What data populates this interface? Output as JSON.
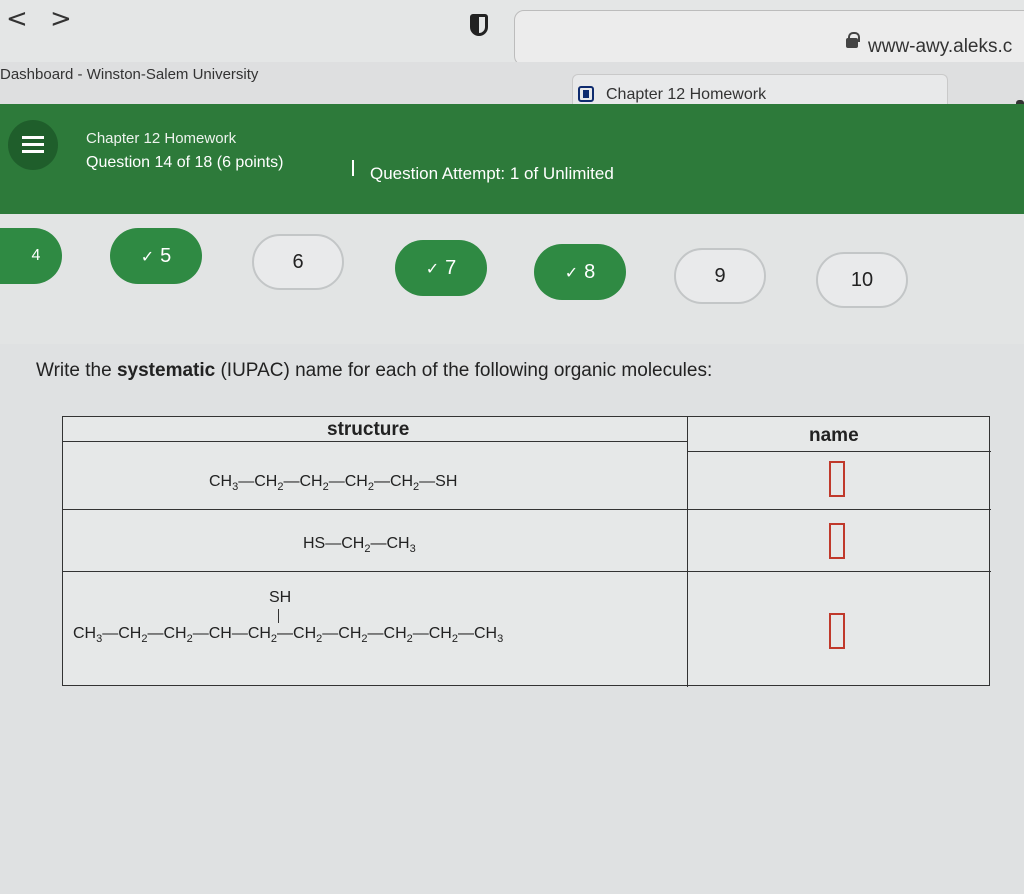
{
  "browser": {
    "back": "<",
    "forward": ">",
    "url": "www-awy.aleks.c"
  },
  "tabs": {
    "left_title": "Dashboard - Winston-Salem University",
    "right_title": "Chapter 12 Homework"
  },
  "header": {
    "title": "Chapter 12 Homework",
    "question_info": "Question 14 of 18 (6 points)",
    "attempt_info": "Question Attempt: 1 of Unlimited"
  },
  "question_nav": [
    {
      "label": "4",
      "status": "current"
    },
    {
      "label": "5",
      "status": "done"
    },
    {
      "label": "6",
      "status": "todo"
    },
    {
      "label": "7",
      "status": "done"
    },
    {
      "label": "8",
      "status": "done"
    },
    {
      "label": "9",
      "status": "todo"
    },
    {
      "label": "10",
      "status": "todo"
    }
  ],
  "question": {
    "prompt_pre": "Write the ",
    "prompt_bold": "systematic",
    "prompt_post": " (IUPAC) name for each of the following organic molecules:",
    "col_structure": "structure",
    "col_name": "name",
    "rows": [
      {
        "formula_html": "CH<sub>3</sub>—CH<sub>2</sub>—CH<sub>2</sub>—CH<sub>2</sub>—CH<sub>2</sub>—SH",
        "name": ""
      },
      {
        "formula_html": "HS—CH<sub>2</sub>—CH<sub>3</sub>",
        "name": ""
      },
      {
        "formula_html": "CH<sub>3</sub>—CH<sub>2</sub>—CH<sub>2</sub>—CH—CH<sub>2</sub>—CH<sub>2</sub>—CH<sub>2</sub>—CH<sub>2</sub>—CH<sub>2</sub>—CH<sub>3</sub>",
        "substituent": "SH",
        "name": ""
      }
    ]
  },
  "colors": {
    "header_green": "#2d7a3a",
    "done_green": "#2f8a43",
    "answer_box": "#c0392b"
  }
}
